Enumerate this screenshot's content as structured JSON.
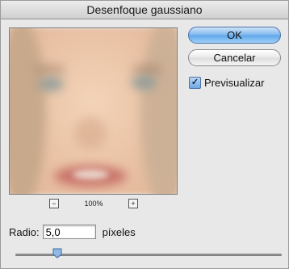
{
  "dialog": {
    "title": "Desenfoque gaussiano"
  },
  "zoom": {
    "out_symbol": "−",
    "in_symbol": "+",
    "level": "100%"
  },
  "buttons": {
    "ok": "OK",
    "cancel": "Cancelar"
  },
  "preview_toggle": {
    "label": "Previsualizar",
    "checked": true,
    "check_glyph": "✓"
  },
  "radius": {
    "label": "Radio:",
    "value": "5,0",
    "unit": "píxeles"
  },
  "slider": {
    "position_fraction": 0.15
  },
  "colors": {
    "accent": "#6ea7e2",
    "window_bg": "#e8e8e8"
  }
}
